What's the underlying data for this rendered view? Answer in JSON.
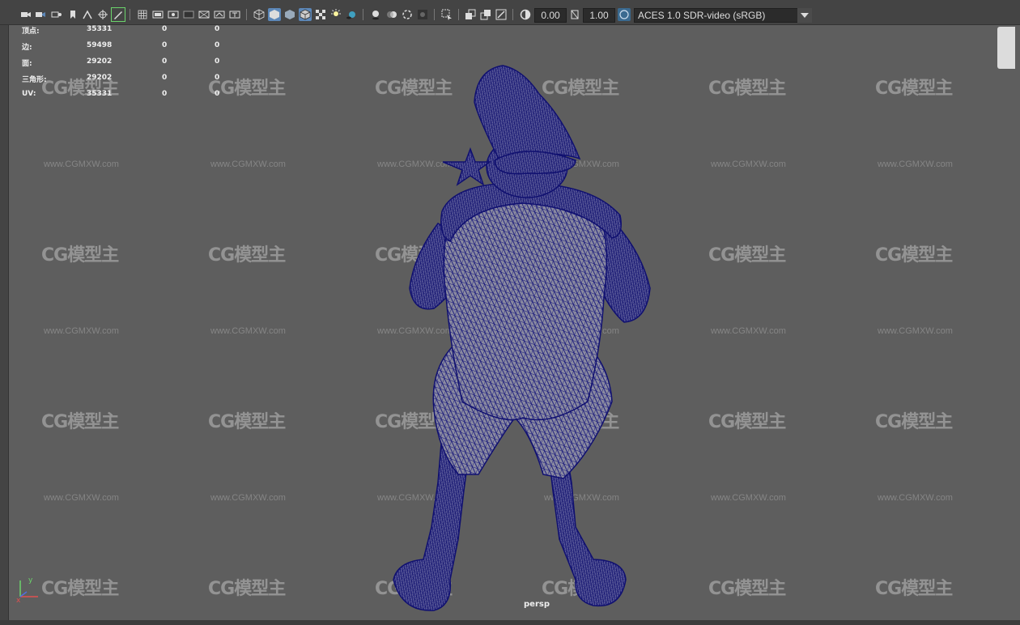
{
  "colors": {
    "toolbar_bg": "#444444",
    "viewport_bg": "#5e5e5e",
    "wire": "#1a1a7a",
    "mesh_fill": "#8a8aa0",
    "active_icon": "#5c87b8"
  },
  "toolbar": {
    "exposure_value": "0.00",
    "gamma_value": "1.00",
    "color_space": "ACES 1.0 SDR-video (sRGB)",
    "icons": [
      "camera-icon",
      "camera-attributes-icon",
      "bookmark-icon",
      "image-plane-icon",
      "grease-pencil-icon",
      "2d-pan-zoom-icon",
      "grid-icon",
      "film-gate-icon",
      "resolution-gate-icon",
      "gate-mask-icon",
      "field-chart-icon",
      "safe-action-icon",
      "safe-title-icon",
      "wireframe-icon",
      "smooth-shade-icon",
      "wireframe-on-shaded-icon",
      "textured-icon",
      "use-all-lights-icon",
      "shadows-icon",
      "screen-space-ao-icon",
      "motion-blur-icon",
      "anti-aliasing-icon",
      "depth-of-field-icon",
      "isolate-select-icon",
      "xray-icon",
      "xray-active-components-icon",
      "xray-joints-icon",
      "exposure-icon",
      "gamma-icon",
      "color-management-icon"
    ]
  },
  "hud": {
    "rows": [
      {
        "label": "顶点:",
        "v1": "35331",
        "v2": "0",
        "v3": "0"
      },
      {
        "label": "边:",
        "v1": "59498",
        "v2": "0",
        "v3": "0"
      },
      {
        "label": "面:",
        "v1": "29202",
        "v2": "0",
        "v3": "0"
      },
      {
        "label": "三角形:",
        "v1": "29202",
        "v2": "0",
        "v3": "0"
      },
      {
        "label": "UV:",
        "v1": "35331",
        "v2": "0",
        "v3": "0"
      }
    ]
  },
  "watermark": {
    "logo_text": "CG模型主",
    "url_text": "www.CGMXW.com"
  },
  "viewport": {
    "camera_label": "persp",
    "axis_y": "y",
    "axis_x": "x"
  }
}
